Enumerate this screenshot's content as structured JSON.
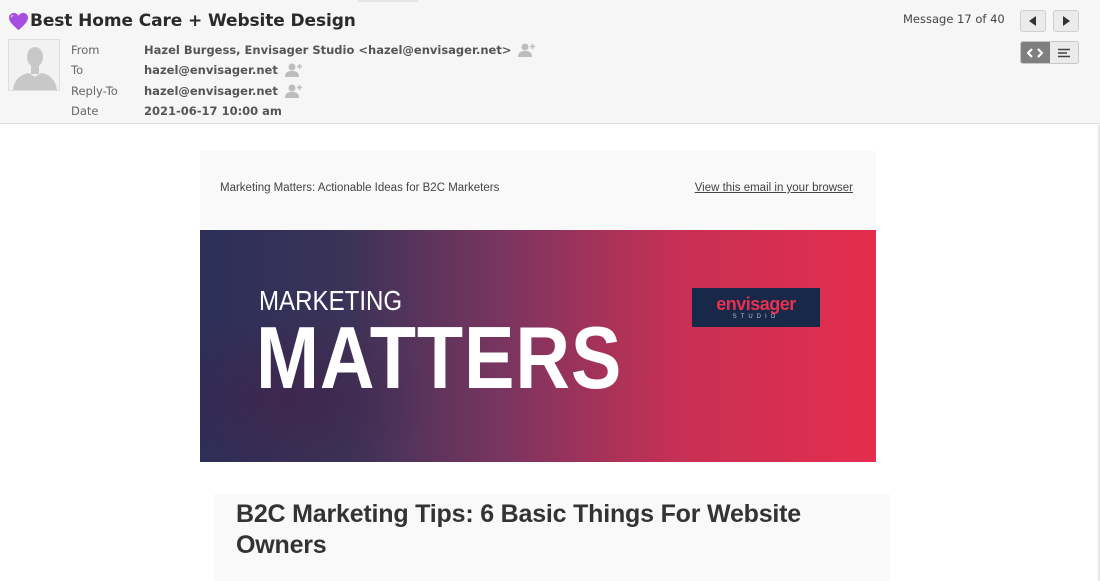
{
  "email": {
    "subject_emoji": "purple-heart",
    "subject": "Best Home Care + Website Design",
    "fields": [
      {
        "label": "From",
        "value": "Hazel Burgess, Envisager Studio <hazel@envisager.net>",
        "add_contact": true
      },
      {
        "label": "To",
        "value": "hazel@envisager.net",
        "add_contact": true
      },
      {
        "label": "Reply-To",
        "value": "hazel@envisager.net",
        "add_contact": true
      },
      {
        "label": "Date",
        "value": "2021-06-17 10:00 am",
        "add_contact": false
      }
    ],
    "message_counter": "Message 17 of 40",
    "nav": {
      "prev_icon": "triangle-left-icon",
      "next_icon": "triangle-right-icon"
    },
    "view_toggle": {
      "options": [
        "html-view",
        "plain-text-view"
      ],
      "selected": "html-view"
    }
  },
  "newsletter": {
    "preheader": "Marketing Matters: Actionable Ideas for B2C Marketers",
    "view_in_browser": "View this email in your browser",
    "hero": {
      "line1": "MARKETING",
      "line2": "MATTERS",
      "logo_main": "envisager",
      "logo_sub": "STUDIO"
    },
    "article_title": "B2C Marketing Tips: 6 Basic Things For Website Owners"
  },
  "colors": {
    "accent_red": "#e52d4d",
    "navy": "#2c2f58",
    "logo_bg": "#182848"
  }
}
